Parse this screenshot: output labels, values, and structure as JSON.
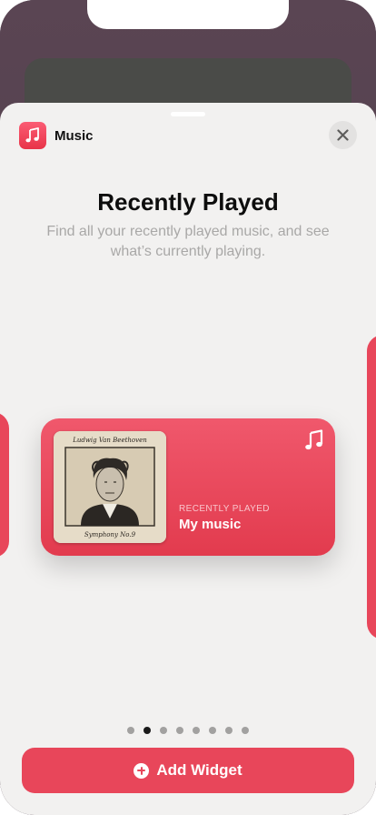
{
  "app": {
    "name": "Music",
    "icon": "music-note-icon"
  },
  "sheet": {
    "title": "Recently Played",
    "subtitle": "Find all your recently played music, and see what’s currently playing."
  },
  "widget": {
    "label": "RECENTLY PLAYED",
    "title": "My music",
    "album": {
      "top_text": "Ludwig Van Beethoven",
      "bottom_text": "Symphony No.9"
    },
    "icon": "music-note-icon"
  },
  "pagination": {
    "count": 8,
    "active_index": 1
  },
  "actions": {
    "add_label": "Add Widget",
    "close_icon": "close-icon"
  },
  "colors": {
    "accent": "#e8465a",
    "sheet_bg": "#f2f1f0"
  }
}
